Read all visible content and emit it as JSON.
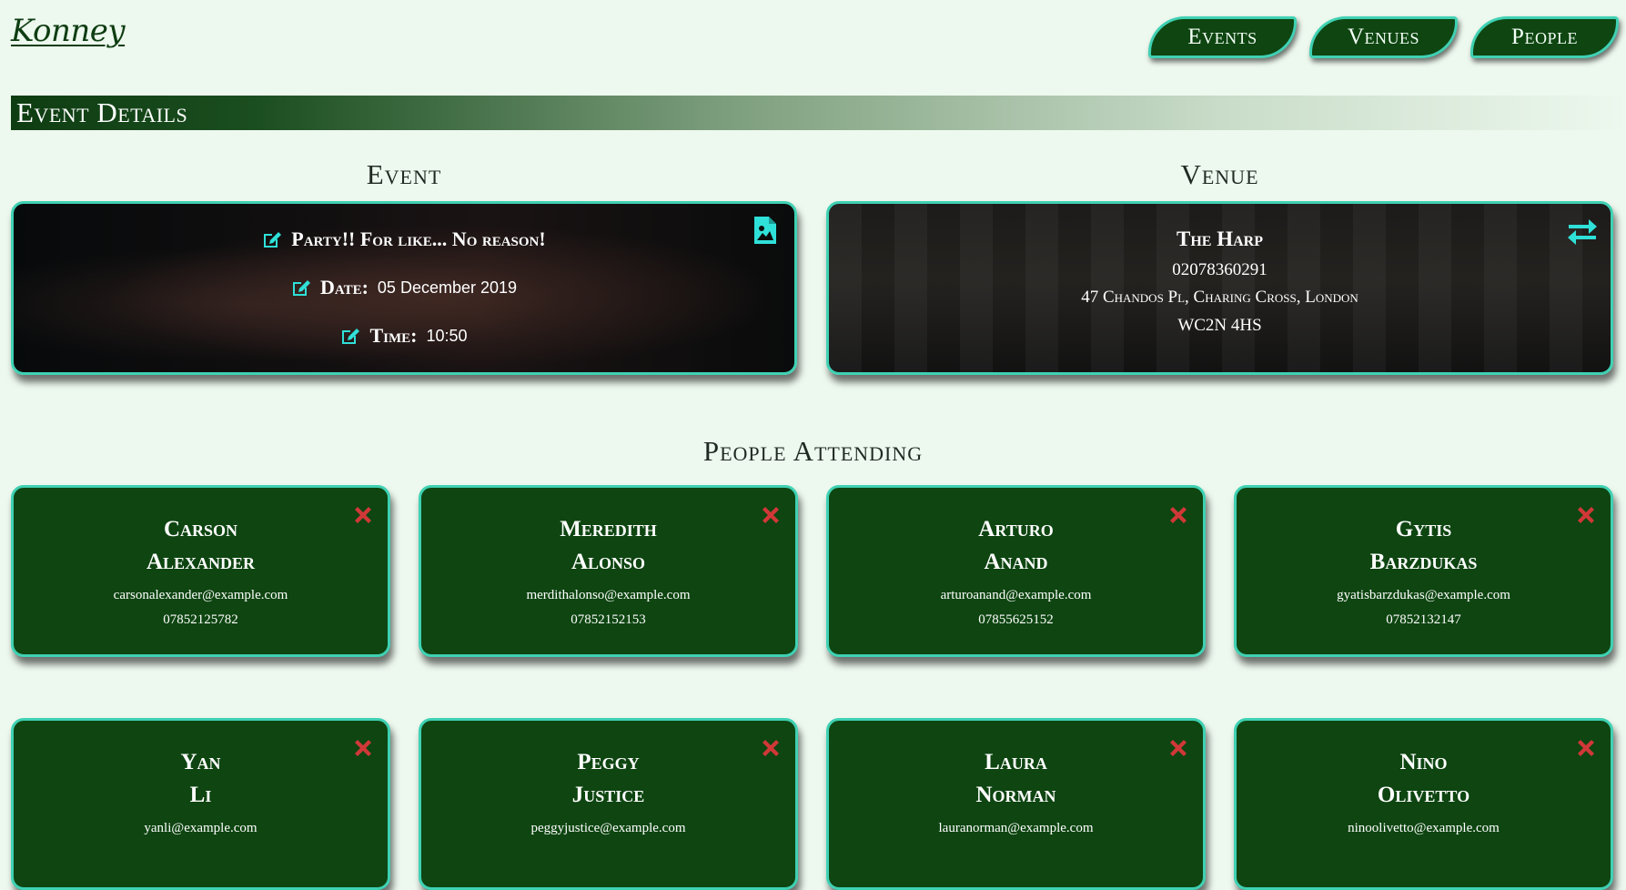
{
  "app": {
    "logo": "Konney"
  },
  "nav": {
    "events": "Events",
    "venues": "Venues",
    "people": "People"
  },
  "page": {
    "banner": "Event Details"
  },
  "event": {
    "heading": "Event",
    "title": "Party!! For like... No reason!",
    "date_label": "Date:",
    "date_value": "05 December 2019",
    "time_label": "Time:",
    "time_value": "10:50"
  },
  "venue": {
    "heading": "Venue",
    "name": "The Harp",
    "phone": "02078360291",
    "address": "47 Chandos Pl, Charing Cross, London",
    "postcode": "WC2N 4HS"
  },
  "attendees": {
    "heading": "People Attending",
    "people": [
      {
        "first": "Carson",
        "last": "Alexander",
        "email": "carsonalexander@example.com",
        "phone": "07852125782"
      },
      {
        "first": "Meredith",
        "last": "Alonso",
        "email": "merdithalonso@example.com",
        "phone": "07852152153"
      },
      {
        "first": "Arturo",
        "last": "Anand",
        "email": "arturoanand@example.com",
        "phone": "07855625152"
      },
      {
        "first": "Gytis",
        "last": "Barzdukas",
        "email": "gyatisbarzdukas@example.com",
        "phone": "07852132147"
      },
      {
        "first": "Yan",
        "last": "Li",
        "email": "yanli@example.com",
        "phone": ""
      },
      {
        "first": "Peggy",
        "last": "Justice",
        "email": "peggyjustice@example.com",
        "phone": ""
      },
      {
        "first": "Laura",
        "last": "Norman",
        "email": "lauranorman@example.com",
        "phone": ""
      },
      {
        "first": "Nino",
        "last": "Olivetto",
        "email": "ninoolivetto@example.com",
        "phone": ""
      }
    ]
  },
  "colors": {
    "accent": "#3fd1b3",
    "card_bg": "#0e4511",
    "delete": "#d03838"
  }
}
